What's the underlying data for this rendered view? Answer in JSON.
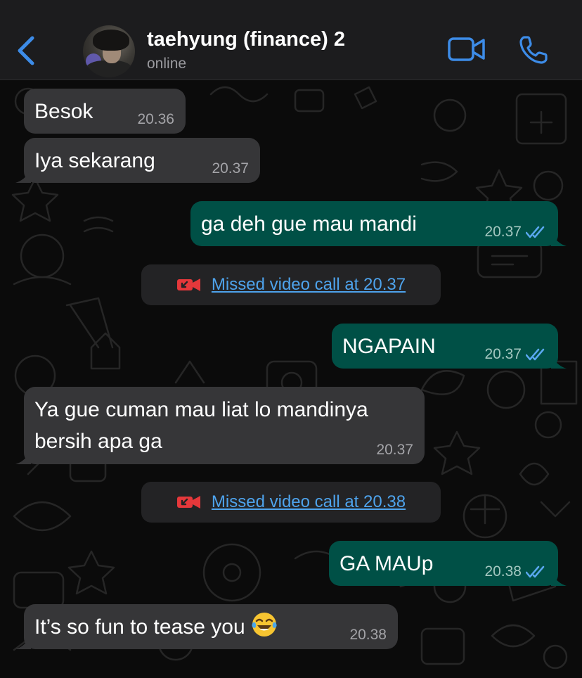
{
  "header": {
    "contact_name": "taehyung (finance) 2",
    "status": "online",
    "back_icon": "chevron-left-icon",
    "video_icon": "video-camera-icon",
    "phone_icon": "phone-icon"
  },
  "colors": {
    "accent": "#3d8ce8",
    "incoming_bubble": "#363638",
    "outgoing_bubble": "#005046",
    "missed_call_red": "#e5383b",
    "link": "#4ea3ec"
  },
  "messages": [
    {
      "direction": "incoming",
      "text": "Besok",
      "time": "20.36"
    },
    {
      "direction": "incoming",
      "text": "Iya sekarang",
      "time": "20.37"
    },
    {
      "direction": "outgoing",
      "text": "ga deh gue mau mandi",
      "time": "20.37",
      "status": "read"
    },
    {
      "type": "missed_call",
      "icon": "missed-video-call-icon",
      "text": "Missed video call at 20.37"
    },
    {
      "direction": "outgoing",
      "text": "NGAPAIN",
      "time": "20.37",
      "status": "read"
    },
    {
      "direction": "incoming",
      "line1": "Ya gue cuman mau liat lo mandinya",
      "line2": "bersih apa ga",
      "time": "20.37"
    },
    {
      "type": "missed_call",
      "icon": "missed-video-call-icon",
      "text": "Missed video call at 20.38"
    },
    {
      "direction": "outgoing",
      "text": "GA MAUp",
      "time": "20.38",
      "status": "read"
    },
    {
      "direction": "incoming",
      "text": "It’s so fun to tease you",
      "emoji": "face-with-tears-of-joy",
      "time": "20.38"
    }
  ]
}
